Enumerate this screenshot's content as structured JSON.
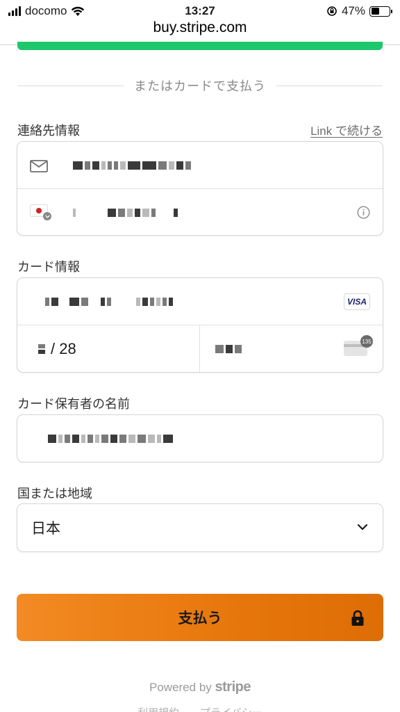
{
  "status_bar": {
    "carrier": "docomo",
    "time": "13:27",
    "battery_percent": "47%",
    "battery_level": 0.47
  },
  "browser": {
    "url": "buy.stripe.com"
  },
  "divider": {
    "text": "またはカードで支払う"
  },
  "contact": {
    "label": "連絡先情報",
    "link_label": "Link で続ける",
    "email_icon": "mail-icon",
    "phone_icon": "flag-jp-icon",
    "info_icon": "info-icon"
  },
  "card": {
    "label": "カード情報",
    "brand": "VISA",
    "expiry_suffix": "/ 28",
    "cvc_badge": "135"
  },
  "cardholder": {
    "label": "カード保有者の名前"
  },
  "country": {
    "label": "国または地域",
    "selected": "日本"
  },
  "pay": {
    "label": "支払う",
    "color_start": "#f38a23",
    "color_end": "#dd6d05"
  },
  "footer": {
    "powered_by": "Powered by",
    "brand": "stripe",
    "links": [
      "利用規約",
      "プライバシー"
    ]
  },
  "colors": {
    "accent_green": "#1ec86a"
  }
}
